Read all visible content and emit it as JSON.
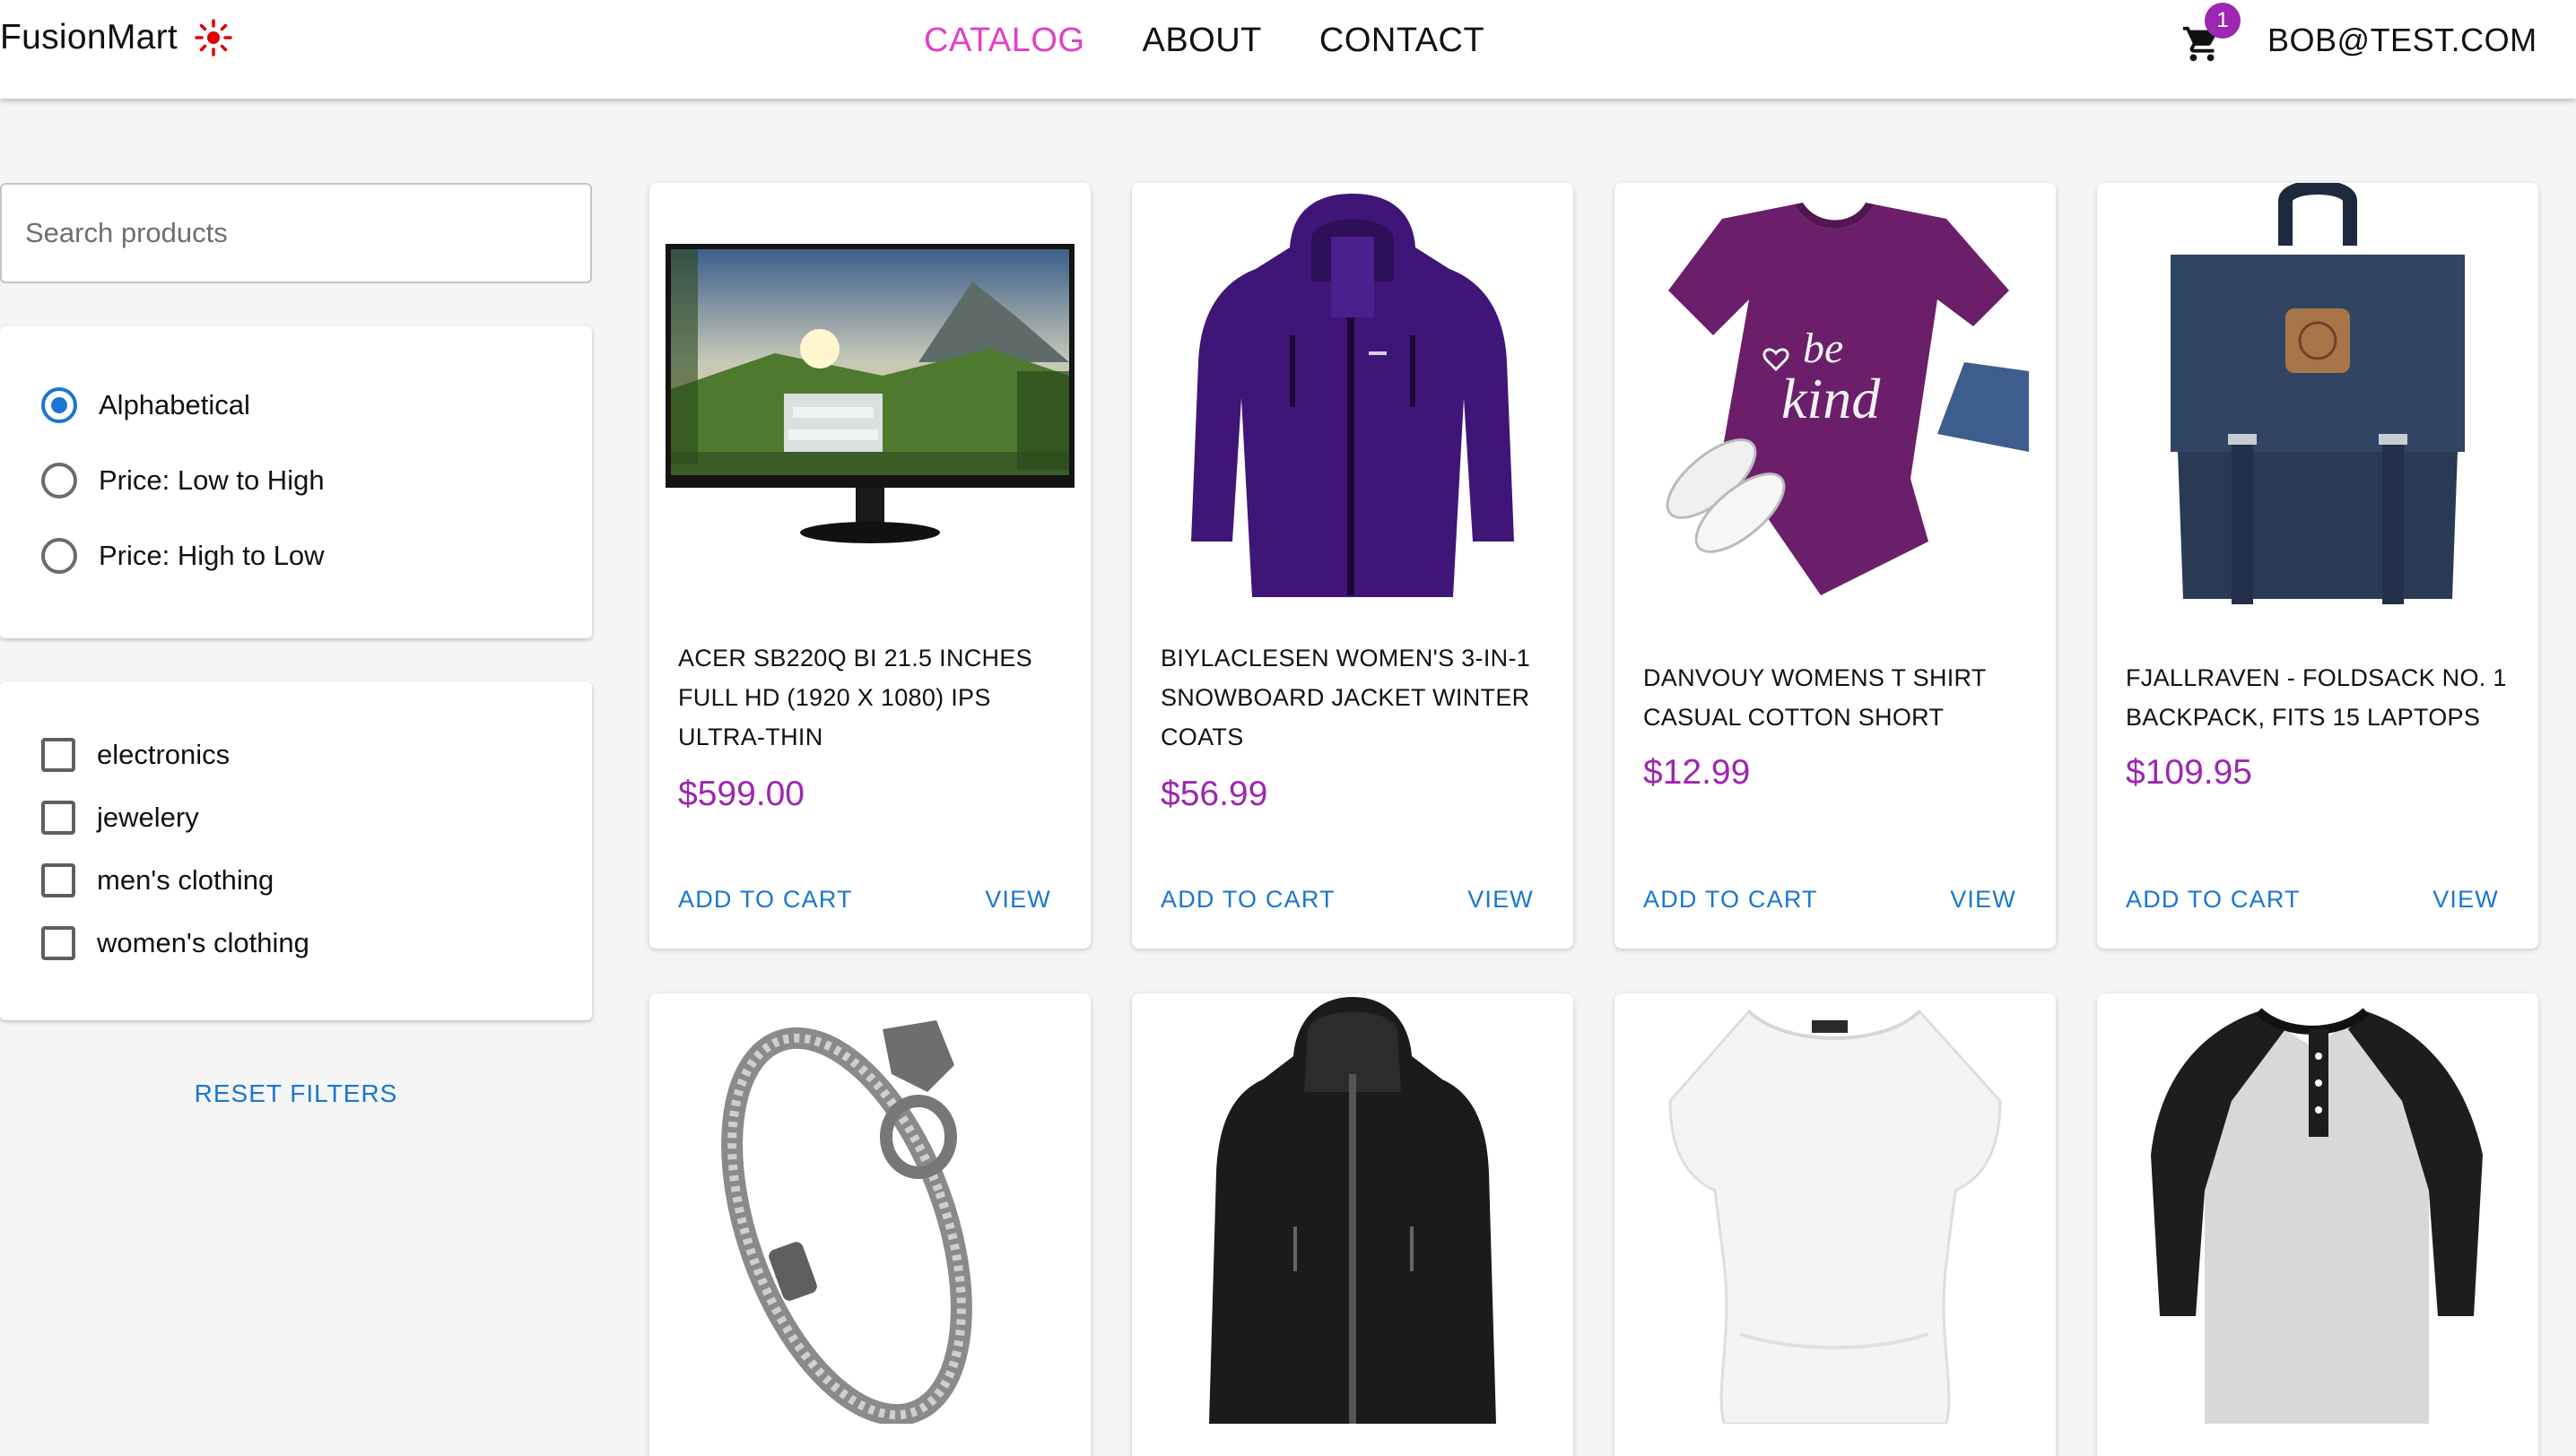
{
  "header": {
    "logo": "FusionMart",
    "nav": [
      "CATALOG",
      "ABOUT",
      "CONTACT"
    ],
    "active_nav": "CATALOG",
    "cart_count": "1",
    "user": "BOB@TEST.COM",
    "accent_color": "#e040c8",
    "badge_color": "#9c27b0"
  },
  "sidebar": {
    "search_placeholder": "Search products",
    "sort_options": [
      "Alphabetical",
      "Price: Low to High",
      "Price: High to Low"
    ],
    "selected_sort": "Alphabetical",
    "categories": [
      "electronics",
      "jewelery",
      "men's clothing",
      "women's clothing"
    ],
    "reset_label": "RESET FILTERS"
  },
  "products": [
    {
      "title": "ACER SB220Q BI 21.5 INCHES FULL HD (1920 X 1080) IPS ULTRA-THIN",
      "price": "$599.00",
      "image": "monitor"
    },
    {
      "title": "BIYLACLESEN WOMEN'S 3-IN-1 SNOWBOARD JACKET WINTER COATS",
      "price": "$56.99",
      "image": "purple-jacket"
    },
    {
      "title": "DANVOUY WOMENS T SHIRT CASUAL COTTON SHORT",
      "price": "$12.99",
      "image": "purple-tshirt"
    },
    {
      "title": "FJALLRAVEN - FOLDSACK NO. 1 BACKPACK, FITS 15 LAPTOPS",
      "price": "$109.95",
      "image": "backpack"
    },
    {
      "title": "",
      "price": "",
      "image": "bracelet"
    },
    {
      "title": "",
      "price": "",
      "image": "leather-jacket"
    },
    {
      "title": "",
      "price": "",
      "image": "white-top"
    },
    {
      "title": "",
      "price": "",
      "image": "raglan-shirt"
    }
  ],
  "card_actions": {
    "add": "ADD TO CART",
    "view": "VIEW"
  },
  "link_color": "#1976d2",
  "price_color": "#9c27b0"
}
